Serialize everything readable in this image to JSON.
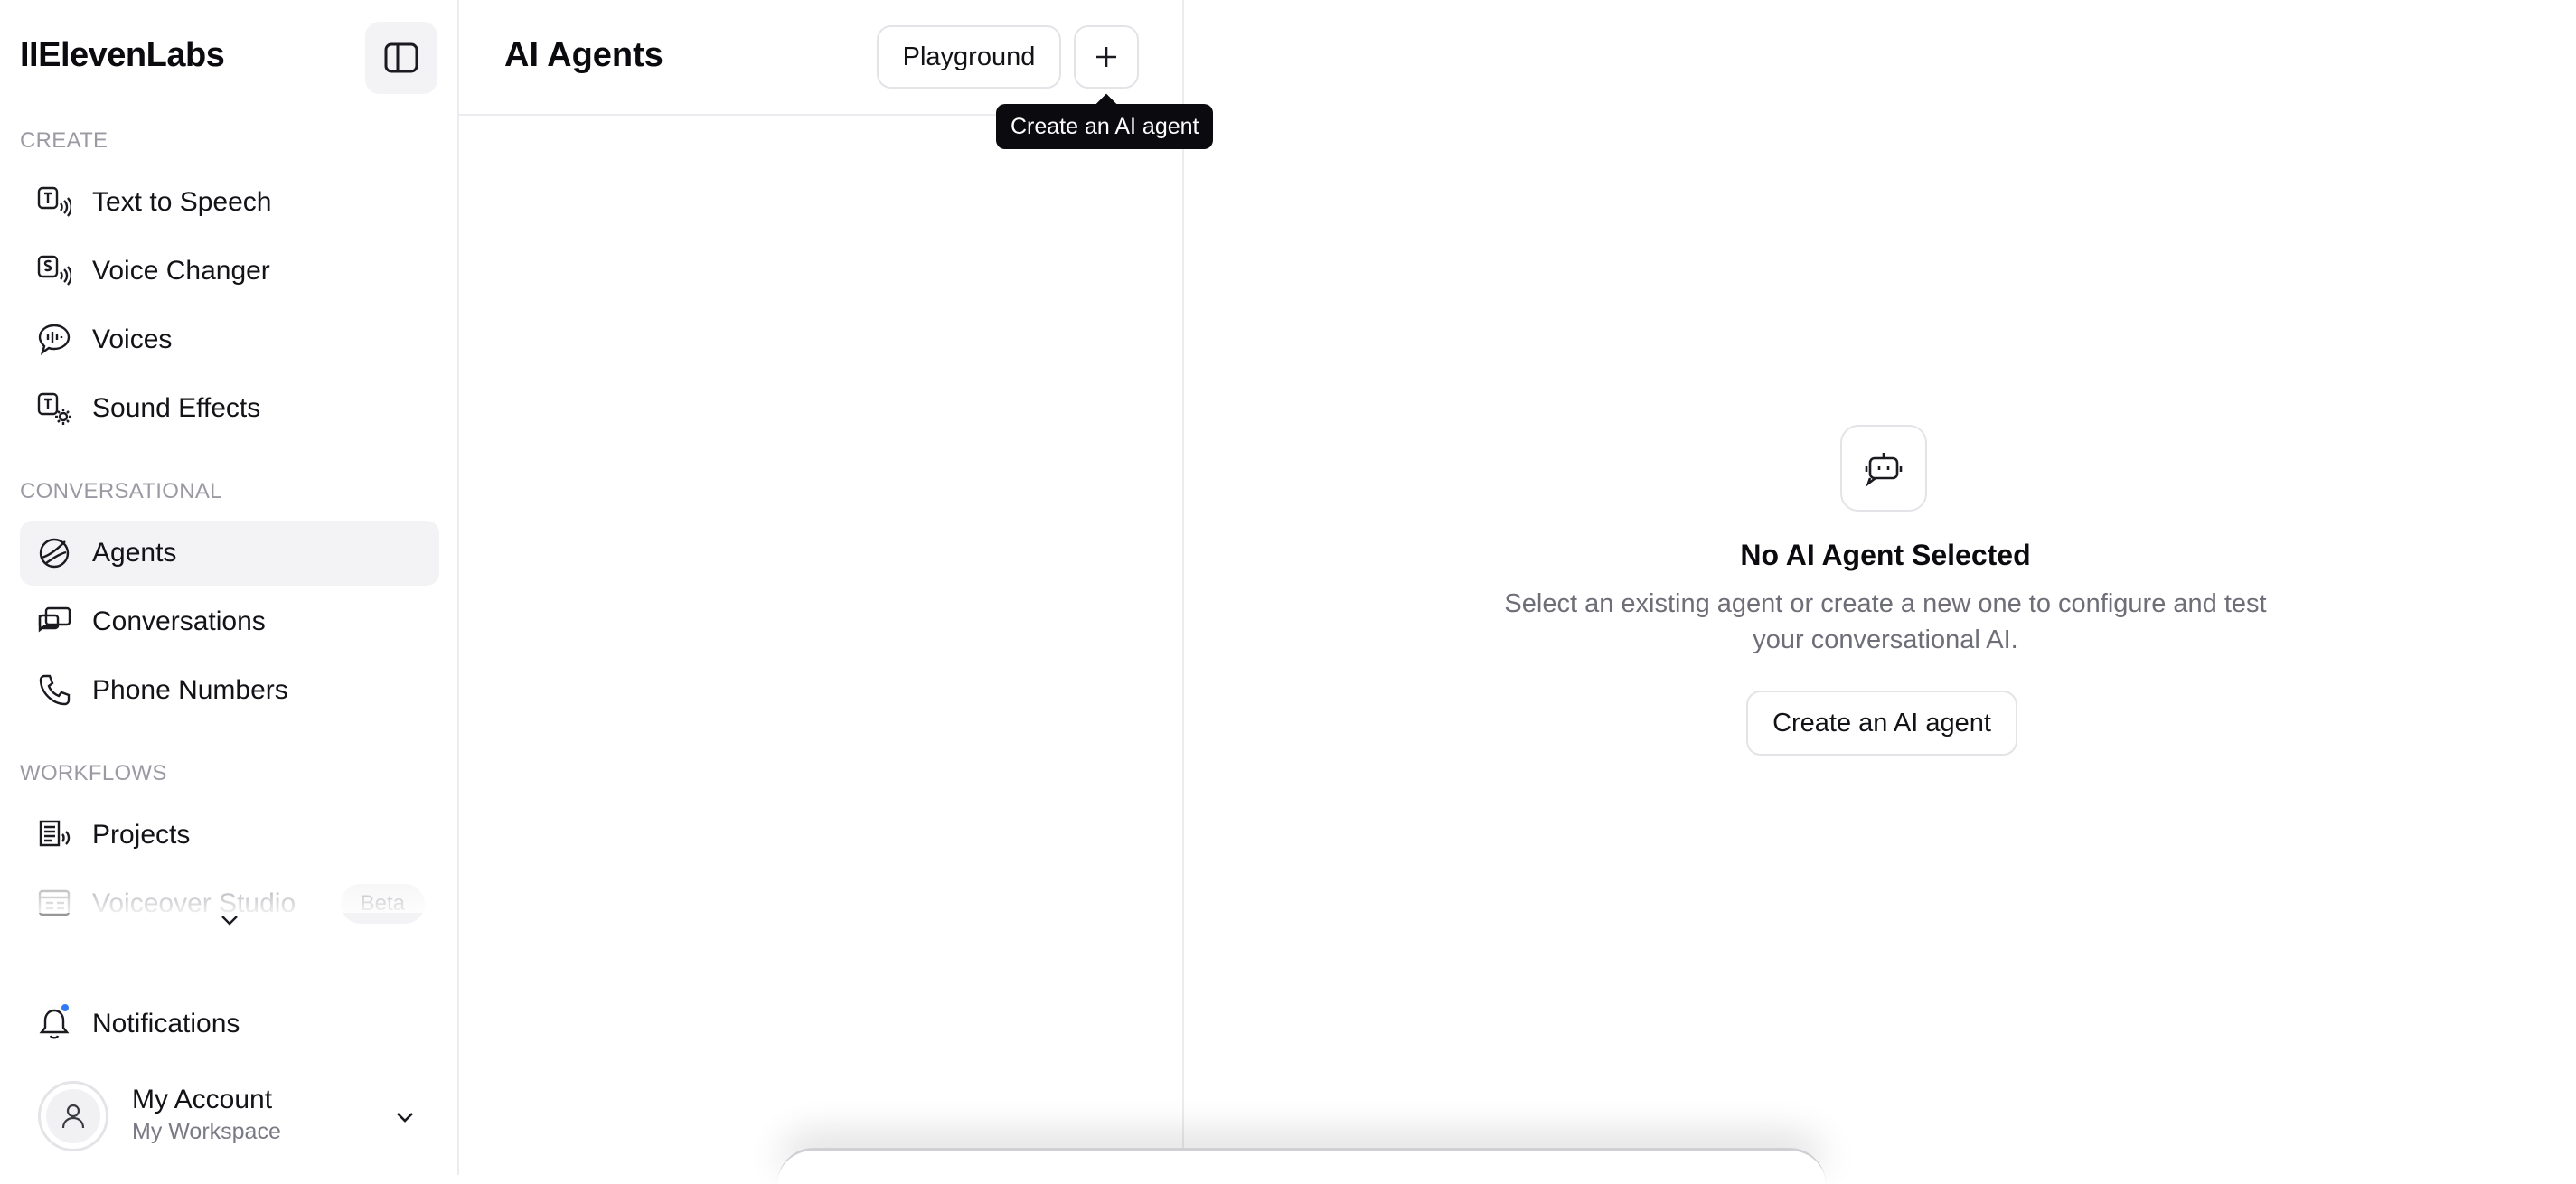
{
  "app": {
    "logo_text": "IIElevenLabs"
  },
  "sidebar": {
    "sections": [
      {
        "label": "CREATE",
        "items": [
          {
            "label": "Text to Speech",
            "icon": "text-to-speech-icon"
          },
          {
            "label": "Voice Changer",
            "icon": "voice-changer-icon"
          },
          {
            "label": "Voices",
            "icon": "voices-icon"
          },
          {
            "label": "Sound Effects",
            "icon": "sound-effects-icon"
          }
        ]
      },
      {
        "label": "CONVERSATIONAL",
        "items": [
          {
            "label": "Agents",
            "icon": "agents-icon",
            "active": true
          },
          {
            "label": "Conversations",
            "icon": "conversations-icon"
          },
          {
            "label": "Phone Numbers",
            "icon": "phone-icon"
          }
        ]
      },
      {
        "label": "WORKFLOWS",
        "items": [
          {
            "label": "Projects",
            "icon": "projects-icon"
          },
          {
            "label": "Voiceover Studio",
            "icon": "voiceover-studio-icon",
            "badge": "Beta"
          }
        ]
      }
    ],
    "notifications": {
      "label": "Notifications",
      "icon": "bell-icon",
      "has_unread": true
    },
    "account": {
      "name": "My Account",
      "workspace": "My Workspace",
      "icon": "user-icon"
    }
  },
  "list_panel": {
    "title": "AI Agents",
    "playground_label": "Playground",
    "add_icon": "plus-icon",
    "tooltip": "Create an AI agent"
  },
  "detail": {
    "empty_icon": "bot-icon",
    "empty_title": "No AI Agent Selected",
    "empty_description": "Select an existing agent or create a new one to configure and test your conversational AI.",
    "create_button_label": "Create an AI agent"
  },
  "colors": {
    "accent_active_bg": "#f3f3f5",
    "notification_dot": "#2f7bf5",
    "tooltip_bg": "#0b0b0f"
  }
}
